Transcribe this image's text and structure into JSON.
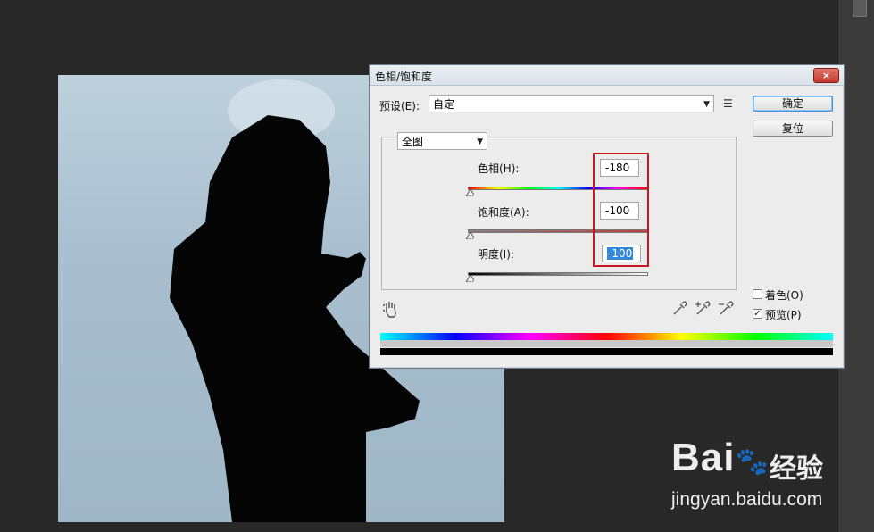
{
  "dialog": {
    "title": "色相/饱和度",
    "close_label": "×",
    "preset_label": "预设(E):",
    "preset_value": "自定",
    "ok_label": "确定",
    "reset_label": "复位",
    "channel_value": "全图",
    "hue": {
      "label": "色相(H):",
      "value": "-180"
    },
    "saturation": {
      "label": "饱和度(A):",
      "value": "-100"
    },
    "lightness": {
      "label": "明度(I):",
      "value": "-100"
    },
    "colorize_label": "着色(O)",
    "preview_label": "预览(P)",
    "colorize_checked": false,
    "preview_checked": true
  },
  "watermark": {
    "logo": "Bai",
    "logo_suffix": "du",
    "name": "经验",
    "url": "jingyan.baidu.com"
  },
  "icons": [
    "close-icon",
    "dropdown-arrow-icon",
    "preset-menu-icon",
    "hand-adjust-icon",
    "eyedropper-icon",
    "eyedropper-add-icon",
    "eyedropper-subtract-icon"
  ],
  "colors": {
    "highlight": "#c8171e",
    "selection": "#3388dd"
  }
}
